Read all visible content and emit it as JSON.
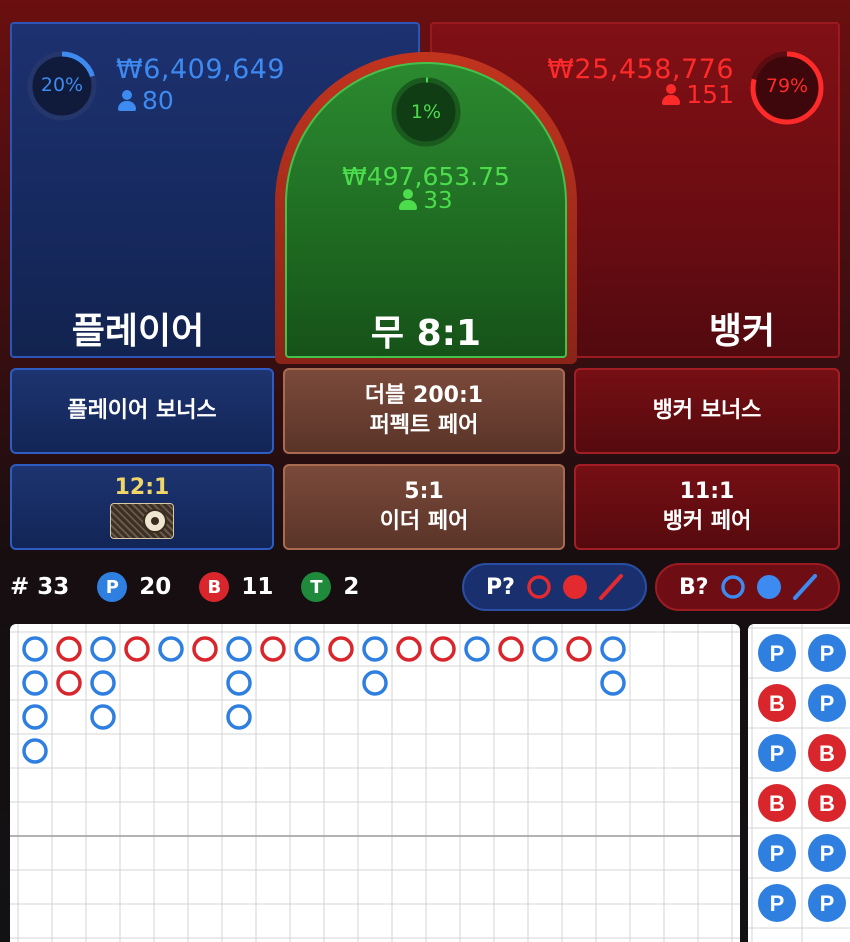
{
  "player": {
    "label": "플레이어",
    "percent_text": "20%",
    "percent": 20,
    "amount": "₩6,409,649",
    "players": "80",
    "color": "#3d8af0"
  },
  "tie": {
    "label": "무",
    "payout": "8:1",
    "percent_text": "1%",
    "percent": 1,
    "amount": "₩497,653.75",
    "players": "33",
    "color": "#4cdc4c"
  },
  "banker": {
    "label": "뱅커",
    "percent_text": "79%",
    "percent": 79,
    "amount": "₩25,458,776",
    "players": "151",
    "color": "#ff2a2a"
  },
  "side_bets": {
    "player_bonus": "플레이어 보너스",
    "double_line1": "더블 200:1",
    "double_line2": "퍼펙트 페어",
    "banker_bonus": "뱅커 보너스",
    "player_pair_payout": "12:1",
    "either_payout": "5:1",
    "either_label": "이더 페어",
    "banker_pair_payout": "11:1",
    "banker_pair_label": "뱅커 페어"
  },
  "stats": {
    "rounds": "# 33",
    "p_label": "P",
    "p_count": "20",
    "b_label": "B",
    "b_count": "11",
    "t_label": "T",
    "t_count": "2"
  },
  "predict": {
    "player_label": "P?",
    "banker_label": "B?"
  },
  "colors": {
    "player_blue": "#2f7fe0",
    "banker_red": "#d9262c",
    "tie_green": "#1f8a3b"
  },
  "big_road": [
    [
      "P",
      "P",
      "P",
      "P"
    ],
    [
      "B",
      "B"
    ],
    [
      "P",
      "P",
      "P"
    ],
    [
      "B"
    ],
    [
      "P"
    ],
    [
      "B"
    ],
    [
      "P",
      "P",
      "P"
    ],
    [
      "B"
    ],
    [
      "P"
    ],
    [
      "B"
    ],
    [
      "P",
      "P"
    ],
    [
      "B"
    ],
    [
      "B"
    ],
    [
      "P"
    ],
    [
      "B"
    ],
    [
      "P"
    ],
    [
      "B"
    ],
    [
      "P",
      "P"
    ]
  ],
  "bead_road": [
    [
      "P",
      "B",
      "P",
      "B",
      "P",
      "P"
    ],
    [
      "P",
      "P",
      "B",
      "B",
      "P",
      "P"
    ]
  ]
}
